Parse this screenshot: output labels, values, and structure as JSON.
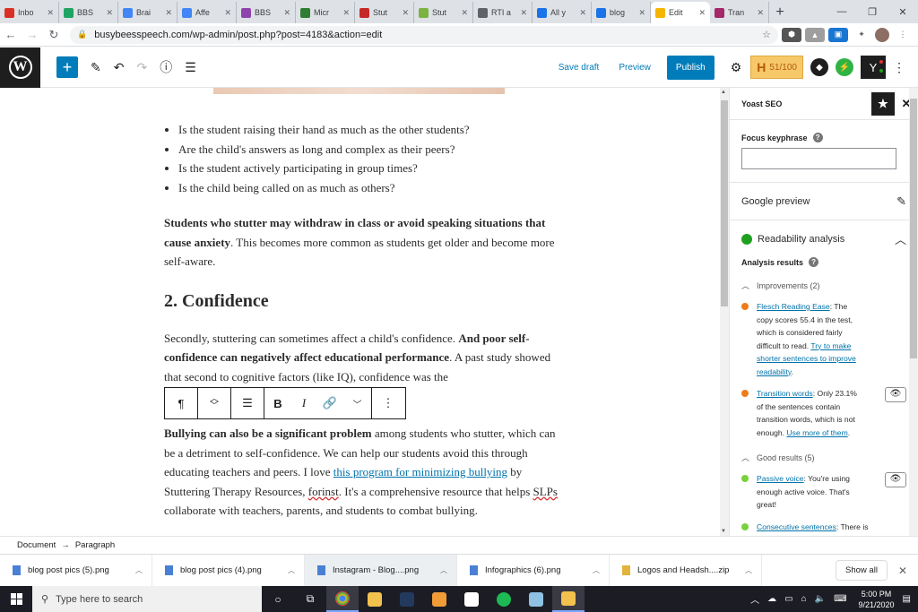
{
  "browser": {
    "tabs": [
      {
        "title": "Inbo",
        "color": "#d93025"
      },
      {
        "title": "BBS",
        "color": "#1fa463"
      },
      {
        "title": "Brai",
        "color": "#4285f4"
      },
      {
        "title": "Affe",
        "color": "#4285f4"
      },
      {
        "title": "BBS",
        "color": "#8e44ad"
      },
      {
        "title": "Micr",
        "color": "#2e7d32"
      },
      {
        "title": "Stut",
        "color": "#c62828"
      },
      {
        "title": "Stut",
        "color": "#7cb342"
      },
      {
        "title": "RTI a",
        "color": "#5f6368"
      },
      {
        "title": "All y",
        "color": "#1a73e8"
      },
      {
        "title": "blog",
        "color": "#1a73e8"
      },
      {
        "title": "Edit",
        "color": "#f5b400",
        "active": true
      },
      {
        "title": "Tran",
        "color": "#a4286a"
      }
    ],
    "url": "busybeesspeech.com/wp-admin/post.php?post=4183&action=edit"
  },
  "editor": {
    "save_draft": "Save draft",
    "preview": "Preview",
    "publish": "Publish",
    "hemingway_score": "51/100",
    "hemingway_letter": "H"
  },
  "post": {
    "bullets": [
      "Is the student raising their hand as much as the other students?",
      "Are the child's answers as long and complex as their peers?",
      "Is the student actively participating in group times?",
      "Is the child being called on as much as others?"
    ],
    "p1_bold": "Students who stutter may withdraw in class or avoid speaking situations that cause anxiety",
    "p1_rest": ".  This becomes more common as students get older and become more self-aware.",
    "heading": "2. Confidence",
    "p2_start": "Secondly, stuttering can sometimes affect a child's confidence.  ",
    "p2_bold": "And poor self-confidence can negatively affect educational performance",
    "p2_rest": ".  A past study showed that second to cognitive factors (like IQ), confidence was the",
    "p3_bold": "Bullying can also be a significant problem",
    "p3_a": " among students who stutter, which can be a detriment to self-confidence.  We can help our students avoid this through educating teachers and peers.  I love ",
    "p3_link": "this program for minimizing bullying",
    "p3_b": " by Stuttering Therapy Resources, ",
    "p3_sq1": "forinst",
    "p3_c": ".  It's a comprehensive resource that helps ",
    "p3_sq2": "SLPs",
    "p3_d": " collaborate with teachers, parents, and students to combat bullying."
  },
  "yoast": {
    "title": "Yoast SEO",
    "focus_keyphrase": "Focus keyphrase",
    "google_preview": "Google preview",
    "readability": "Readability analysis",
    "analysis_results": "Analysis results",
    "improvements": "Improvements (2)",
    "good_results": "Good results (5)",
    "r1_link": "Flesch Reading Ease",
    "r1_text": ": The copy scores 55.4 in the test, which is considered fairly difficult to read. ",
    "r1_link2": "Try to make shorter sentences to improve readability",
    "r2_link": "Transition words",
    "r2_text": ": Only 23.1% of the sentences contain transition words, which is not enough. ",
    "r2_link2": "Use more of them",
    "r3_link": "Passive voice",
    "r3_text": ": You're using enough active voice. That's great!",
    "r4_link": "Consecutive sentences",
    "r4_text": ": There is enough variety in your"
  },
  "breadcrumb": {
    "doc": "Document",
    "arrow": "→",
    "block": "Paragraph"
  },
  "downloads": [
    {
      "name": "blog post pics (5).png"
    },
    {
      "name": "blog post pics (4).png"
    },
    {
      "name": "Instagram - Blog....png",
      "selected": true
    },
    {
      "name": "Infographics (6).png"
    },
    {
      "name": "Logos and Headsh....zip",
      "zip": true
    }
  ],
  "show_all": "Show all",
  "taskbar": {
    "search_placeholder": "Type here to search",
    "time": "5:00 PM",
    "date": "9/21/2020"
  }
}
